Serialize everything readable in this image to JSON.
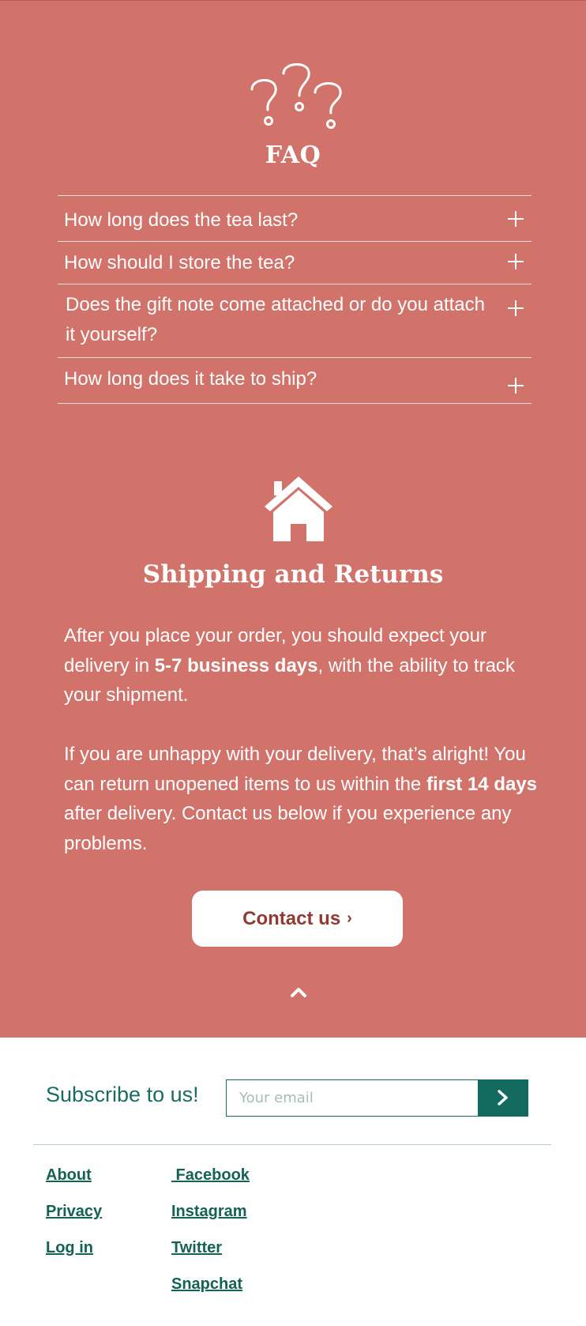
{
  "faq": {
    "title": "FAQ",
    "icon": "question-marks-icon",
    "items": [
      {
        "question": "How long does the tea last?"
      },
      {
        "question": "How should I store the tea?"
      },
      {
        "question": "Does the gift note come attached or do you attach it yourself?"
      },
      {
        "question": "How long does it take to ship?"
      }
    ]
  },
  "shipping": {
    "icon": "house-icon",
    "title": "Shipping and Returns",
    "p1_before": "After you place your order, you should expect your delivery in ",
    "p1_bold": "5-7 business days",
    "p1_after": ", with the ability to track your shipment.",
    "p2_before": "If you are unhappy with your delivery, that’s alright! You can return unopened items to us within the ",
    "p2_bold": "first 14 days",
    "p2_after": " after delivery. Contact us below if you experience any problems.",
    "contact_label": "Contact us",
    "contact_chevron": "›"
  },
  "footer": {
    "subscribe_label": "Subscribe to us!",
    "email_placeholder": "Your email",
    "links_left": [
      "About",
      "Privacy",
      "Log in"
    ],
    "links_right": [
      " Facebook",
      "Instagram",
      "Twitter",
      "Snapchat"
    ]
  },
  "colors": {
    "accent": "#d1736b",
    "teal": "#136b60",
    "button_text": "#8f3a33"
  }
}
